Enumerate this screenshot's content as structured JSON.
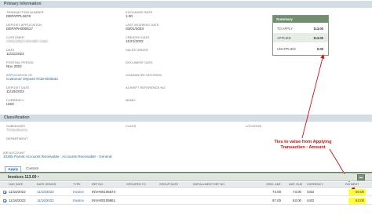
{
  "primary": {
    "header": "Primary Information",
    "transaction_number": {
      "label": "TRANSACTION NUMBER",
      "value": "DEPAPPL3676"
    },
    "deposit_application": {
      "label": "DEPOSIT APPLICATION",
      "value": "DEPAPH000617"
    },
    "customer": {
      "label": "CUSTOMER",
      "value": "C00123624 Brindtht Hotel"
    },
    "date": {
      "label": "DATE",
      "value": "11/21/2022"
    },
    "posting_period": {
      "label": "POSTING PERIOD",
      "value": "Nov 2022"
    },
    "application_of": {
      "label": "APPLICATION OF",
      "value": "Customer Deposit #CDH003532"
    },
    "deposit_date": {
      "label": "DEPOSIT DATE",
      "value": "11/10/2022"
    },
    "currency": {
      "label": "CURRENCY",
      "value": "USD"
    },
    "exchange_rate": {
      "label": "EXCHANGE RATE",
      "value": "1.00"
    },
    "last_modified_date": {
      "label": "LAST MODIFIED DATE",
      "value": "03/01/2023"
    },
    "created_date": {
      "label": "CREATED DATE",
      "value": "11/21/2022"
    },
    "sales_order": {
      "label": "SALES ORDER",
      "value": ""
    },
    "document_date": {
      "label": "DOCUMENT DATE",
      "value": ""
    },
    "guarantee_decision": {
      "label": "GUARANTEE DECISION",
      "value": ""
    },
    "ach_reference": {
      "label": "ACH/EFT REFERENCE NO.",
      "value": ""
    },
    "memo": {
      "label": "MEMO",
      "value": ""
    }
  },
  "summary": {
    "title": "Summary",
    "to_apply": {
      "label": "TO APPLY",
      "value": "113.00"
    },
    "applied": {
      "label": "APPLIED",
      "value": "113.00"
    },
    "unapplied": {
      "label": "UNAPPLIED",
      "value": "0.00"
    }
  },
  "classification": {
    "header": "Classification",
    "subsidiary": {
      "label": "SUBSIDIARY",
      "value": "Tinnjvokeens"
    },
    "class": {
      "label": "CLASS",
      "value": ""
    },
    "location": {
      "label": "LOCATION",
      "value": ""
    },
    "department": {
      "label": "DEPARTMENT",
      "value": ""
    }
  },
  "ar_account": {
    "label": "A/R ACCOUNT",
    "value": "10305 Parent Accounts Receivable : Accounts Receivable - General"
  },
  "annotation": "Ties to value from Applying Transaction : Amount",
  "tabs": [
    {
      "label": "Apply"
    },
    {
      "label": "Custom"
    }
  ],
  "invoices_label": "Invoices 113.00 •",
  "table": {
    "headers": [
      "DUE DATE",
      "DATE ISSUED",
      "TYPE",
      "REF NO.",
      "GROUPED TO",
      "GROUP DATE",
      "INSTALLMENT REF NO.",
      "ORIG. AMT.",
      "AMT. DUE",
      "CURRENCY",
      "PAYMENT"
    ],
    "rows": [
      {
        "due_date": "11/16/2022",
        "date_issued": "11/16/2022",
        "type": "Invoice",
        "ref_no": "INVH00105573",
        "grouped_to": "",
        "group_date": "",
        "installment": "",
        "orig_amt": "73.00",
        "amt_due": "73.00",
        "currency": "USD",
        "payment": "50.00"
      },
      {
        "due_date": "11/16/2022",
        "date_issued": "11/16/2022",
        "type": "Invoice",
        "ref_no": "INVH00109861",
        "grouped_to": "",
        "group_date": "",
        "installment": "",
        "orig_amt": "97.00",
        "amt_due": "63.00",
        "currency": "USD",
        "payment": "63.00"
      }
    ]
  },
  "colors": {
    "annotation": "#d01010",
    "highlight": "#ffff33",
    "summary_header": "#6f8f6f",
    "link": "#2c66b0"
  }
}
